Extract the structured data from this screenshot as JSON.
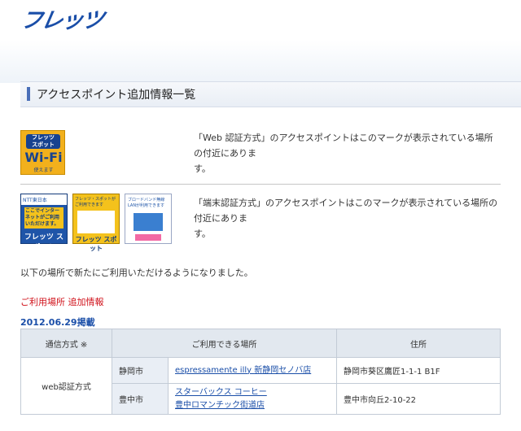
{
  "header": {
    "logo_text": "フレッツ"
  },
  "page": {
    "title": "アクセスポイント追加情報一覧"
  },
  "web_auth": {
    "badge": {
      "top_line1": "フレッツ",
      "top_line2": "スポット",
      "main": "Wi-Fi",
      "sub": "使えます"
    },
    "description_line1": "「Web 認証方式」のアクセスポイントはこのマークが表示されている場所の付近にありま",
    "description_line2": "す。"
  },
  "terminal_auth": {
    "stickers": [
      {
        "head": "NTT東日本",
        "body": "ここでインターネットがご利用いただけます。",
        "foot": "フレッツ スポット"
      },
      {
        "head": "フレッツ・スポットがご利用できます",
        "body": "",
        "foot": "フレッツ スポット"
      },
      {
        "head": "ブロードバンド無線LANが利用できます",
        "body": "",
        "foot": ""
      }
    ],
    "description_line1": "「端末認証方式」のアクセスポイントはこのマークが表示されている場所の付近にありま",
    "description_line2": "す。"
  },
  "intro_text": "以下の場所で新たにご利用いただけるようになりました。",
  "section_heading": "ご利用場所 追加情報",
  "posted_date": "2012.06.29掲載",
  "table": {
    "headers": [
      "通信方式 ※",
      "ご利用できる場所",
      "住所"
    ],
    "method": "web認証方式",
    "rows": [
      {
        "city": "静岡市",
        "places": [
          "espressamente illy 新静岡セノバ店"
        ],
        "address": "静岡市葵区鷹匠1-1-1 B1F"
      },
      {
        "city": "豊中市",
        "places": [
          "スターバックス コーヒー",
          "豊中ロマンチック街道店"
        ],
        "address": "豊中市向丘2-10-22"
      }
    ]
  }
}
